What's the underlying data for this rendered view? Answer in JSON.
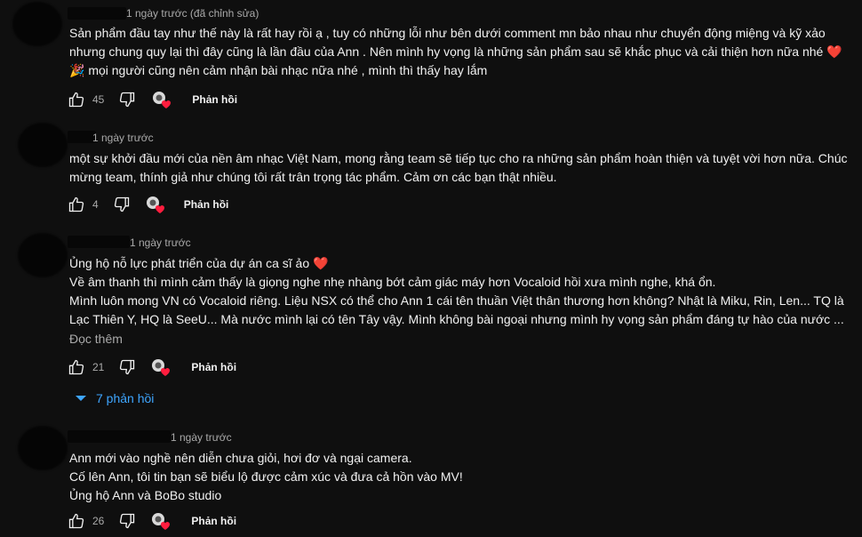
{
  "comments": [
    {
      "time": "1 ngày trước (đã chỉnh sửa)",
      "lines": [
        "Sản phẩm đầu tay như thế này là rất hay rồi ạ , tuy có những lỗi như bên dưới comment mn bảo nhau như chuyển động miệng và kỹ xảo",
        "nhưng chung quy lại thì đây cũng  là lần đầu của Ann . Nên mình hy vọng là những sản phẩm sau sẽ khắc phục và cải thiện hơn nữa nhé ",
        " mọi người cũng nên cảm nhận bài nhạc nữa nhé , mình thì thấy hay lắm"
      ],
      "heart_emoji": "❤️",
      "party_emoji": "🎉",
      "likes": "45",
      "reply_label": "Phản hồi"
    },
    {
      "time": "1 ngày trước",
      "lines": [
        "một sự khởi đầu mới của nền âm nhạc Việt Nam, mong rằng team sẽ tiếp tục cho ra những sản phẩm hoàn thiện và tuyệt vời hơn nữa. Chúc",
        "mừng team, thính giả như chúng tôi rất trân trọng tác phẩm. Cảm ơn các bạn thật nhiều."
      ],
      "likes": "4",
      "reply_label": "Phản hồi"
    },
    {
      "time": "1 ngày trước",
      "lines": [
        "Ủng hộ nỗ lực phát triển của dự án ca sĩ ảo ",
        "Về âm thanh thì mình cảm thấy là giọng nghe nhẹ nhàng bớt cảm giác máy hơn Vocaloid hồi xưa mình nghe, khá ổn.",
        "Mình luôn mong VN có Vocaloid riêng. Liệu NSX có thể cho Ann 1 cái tên thuần Việt thân thương hơn không? Nhật là Miku, Rin, Len... TQ là",
        "Lạc Thiên Y, HQ là SeeU... Mà nước mình lại có tên Tây vậy. Mình không bài ngoại nhưng mình hy vọng sản phẩm đáng tự hào của nước ..."
      ],
      "heart_emoji": "❤️",
      "read_more": "Đọc thêm",
      "likes": "21",
      "reply_label": "Phản hồi",
      "replies_toggle": "7 phản hồi"
    },
    {
      "time": "1 ngày trước",
      "lines": [
        "Ann mới vào nghề nên diễn chưa giỏi, hơi đơ và ngại camera.",
        "Cố lên Ann, tôi tin bạn sẽ biểu lộ được cảm xúc và đưa cả hồn vào MV!",
        "Ủng hộ Ann và BoBo studio"
      ],
      "likes": "26",
      "reply_label": "Phản hồi"
    }
  ],
  "colors": {
    "background": "#0f0f0f",
    "text": "#f1f1f1",
    "meta": "#aaaaaa",
    "link": "#3ea6ff",
    "heart": "#e0245e"
  },
  "icons": [
    "like-icon",
    "dislike-icon",
    "creator-heart-icon",
    "chevron-down-icon"
  ]
}
